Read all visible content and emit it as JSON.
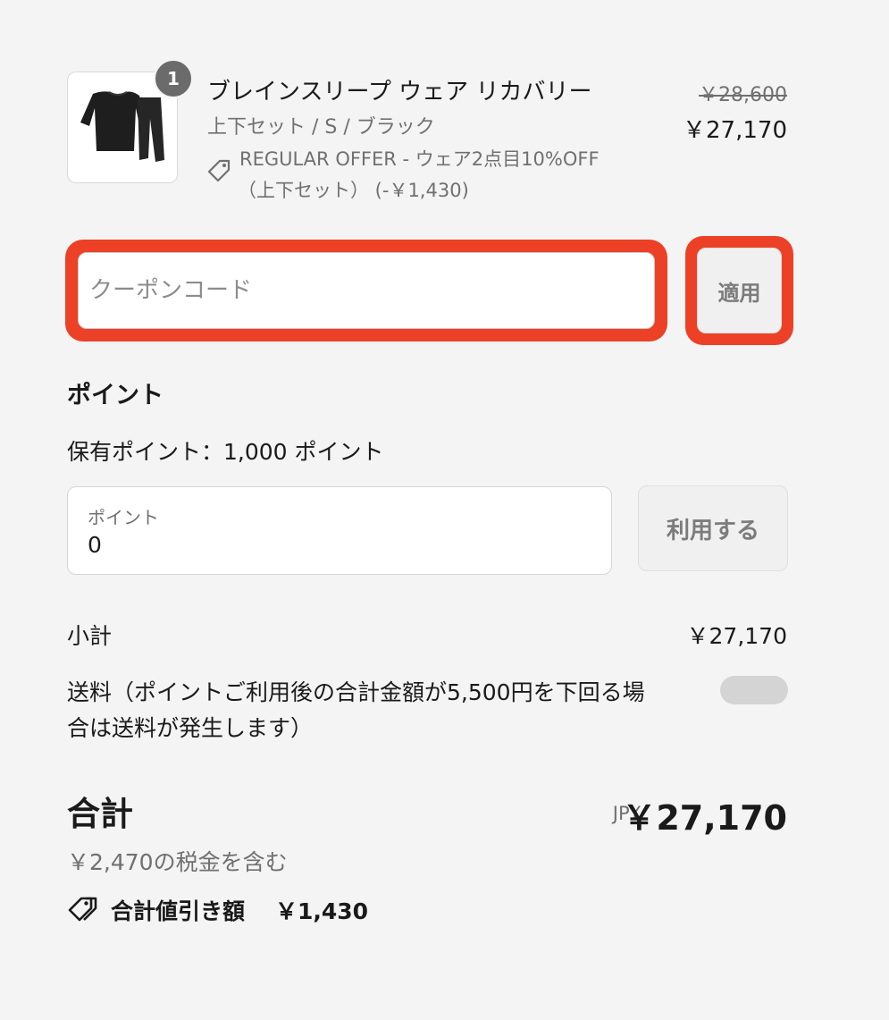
{
  "product": {
    "quantity": "1",
    "name": "ブレインスリープ ウェア リカバリー",
    "variant": "上下セット / S / ブラック",
    "offer_line1": "REGULAR OFFER - ウェア2点目10%OFF",
    "offer_line2": "（上下セット） (-￥1,430)",
    "original_price": "￥28,600",
    "current_price": "￥27,170"
  },
  "coupon": {
    "placeholder": "クーポンコード",
    "apply_label": "適用",
    "highlight_color": "#ec4127"
  },
  "points": {
    "heading": "ポイント",
    "balance_text": "保有ポイント：1,000 ポイント",
    "field_label": "ポイント",
    "field_value": "0",
    "use_label": "利用する"
  },
  "summary": {
    "subtotal_label": "小計",
    "subtotal_value": "￥27,170",
    "shipping_label_line1": "送料（ポイントご利用後の合計金額が5,500円を下回る場",
    "shipping_label_line2": "合は送料が発生します）",
    "total_label": "合計",
    "currency": "JPY",
    "total_value": "￥27,170",
    "tax_text": "￥2,470の税金を含む",
    "discount_label": "合計値引き額",
    "discount_value": "￥1,430"
  }
}
